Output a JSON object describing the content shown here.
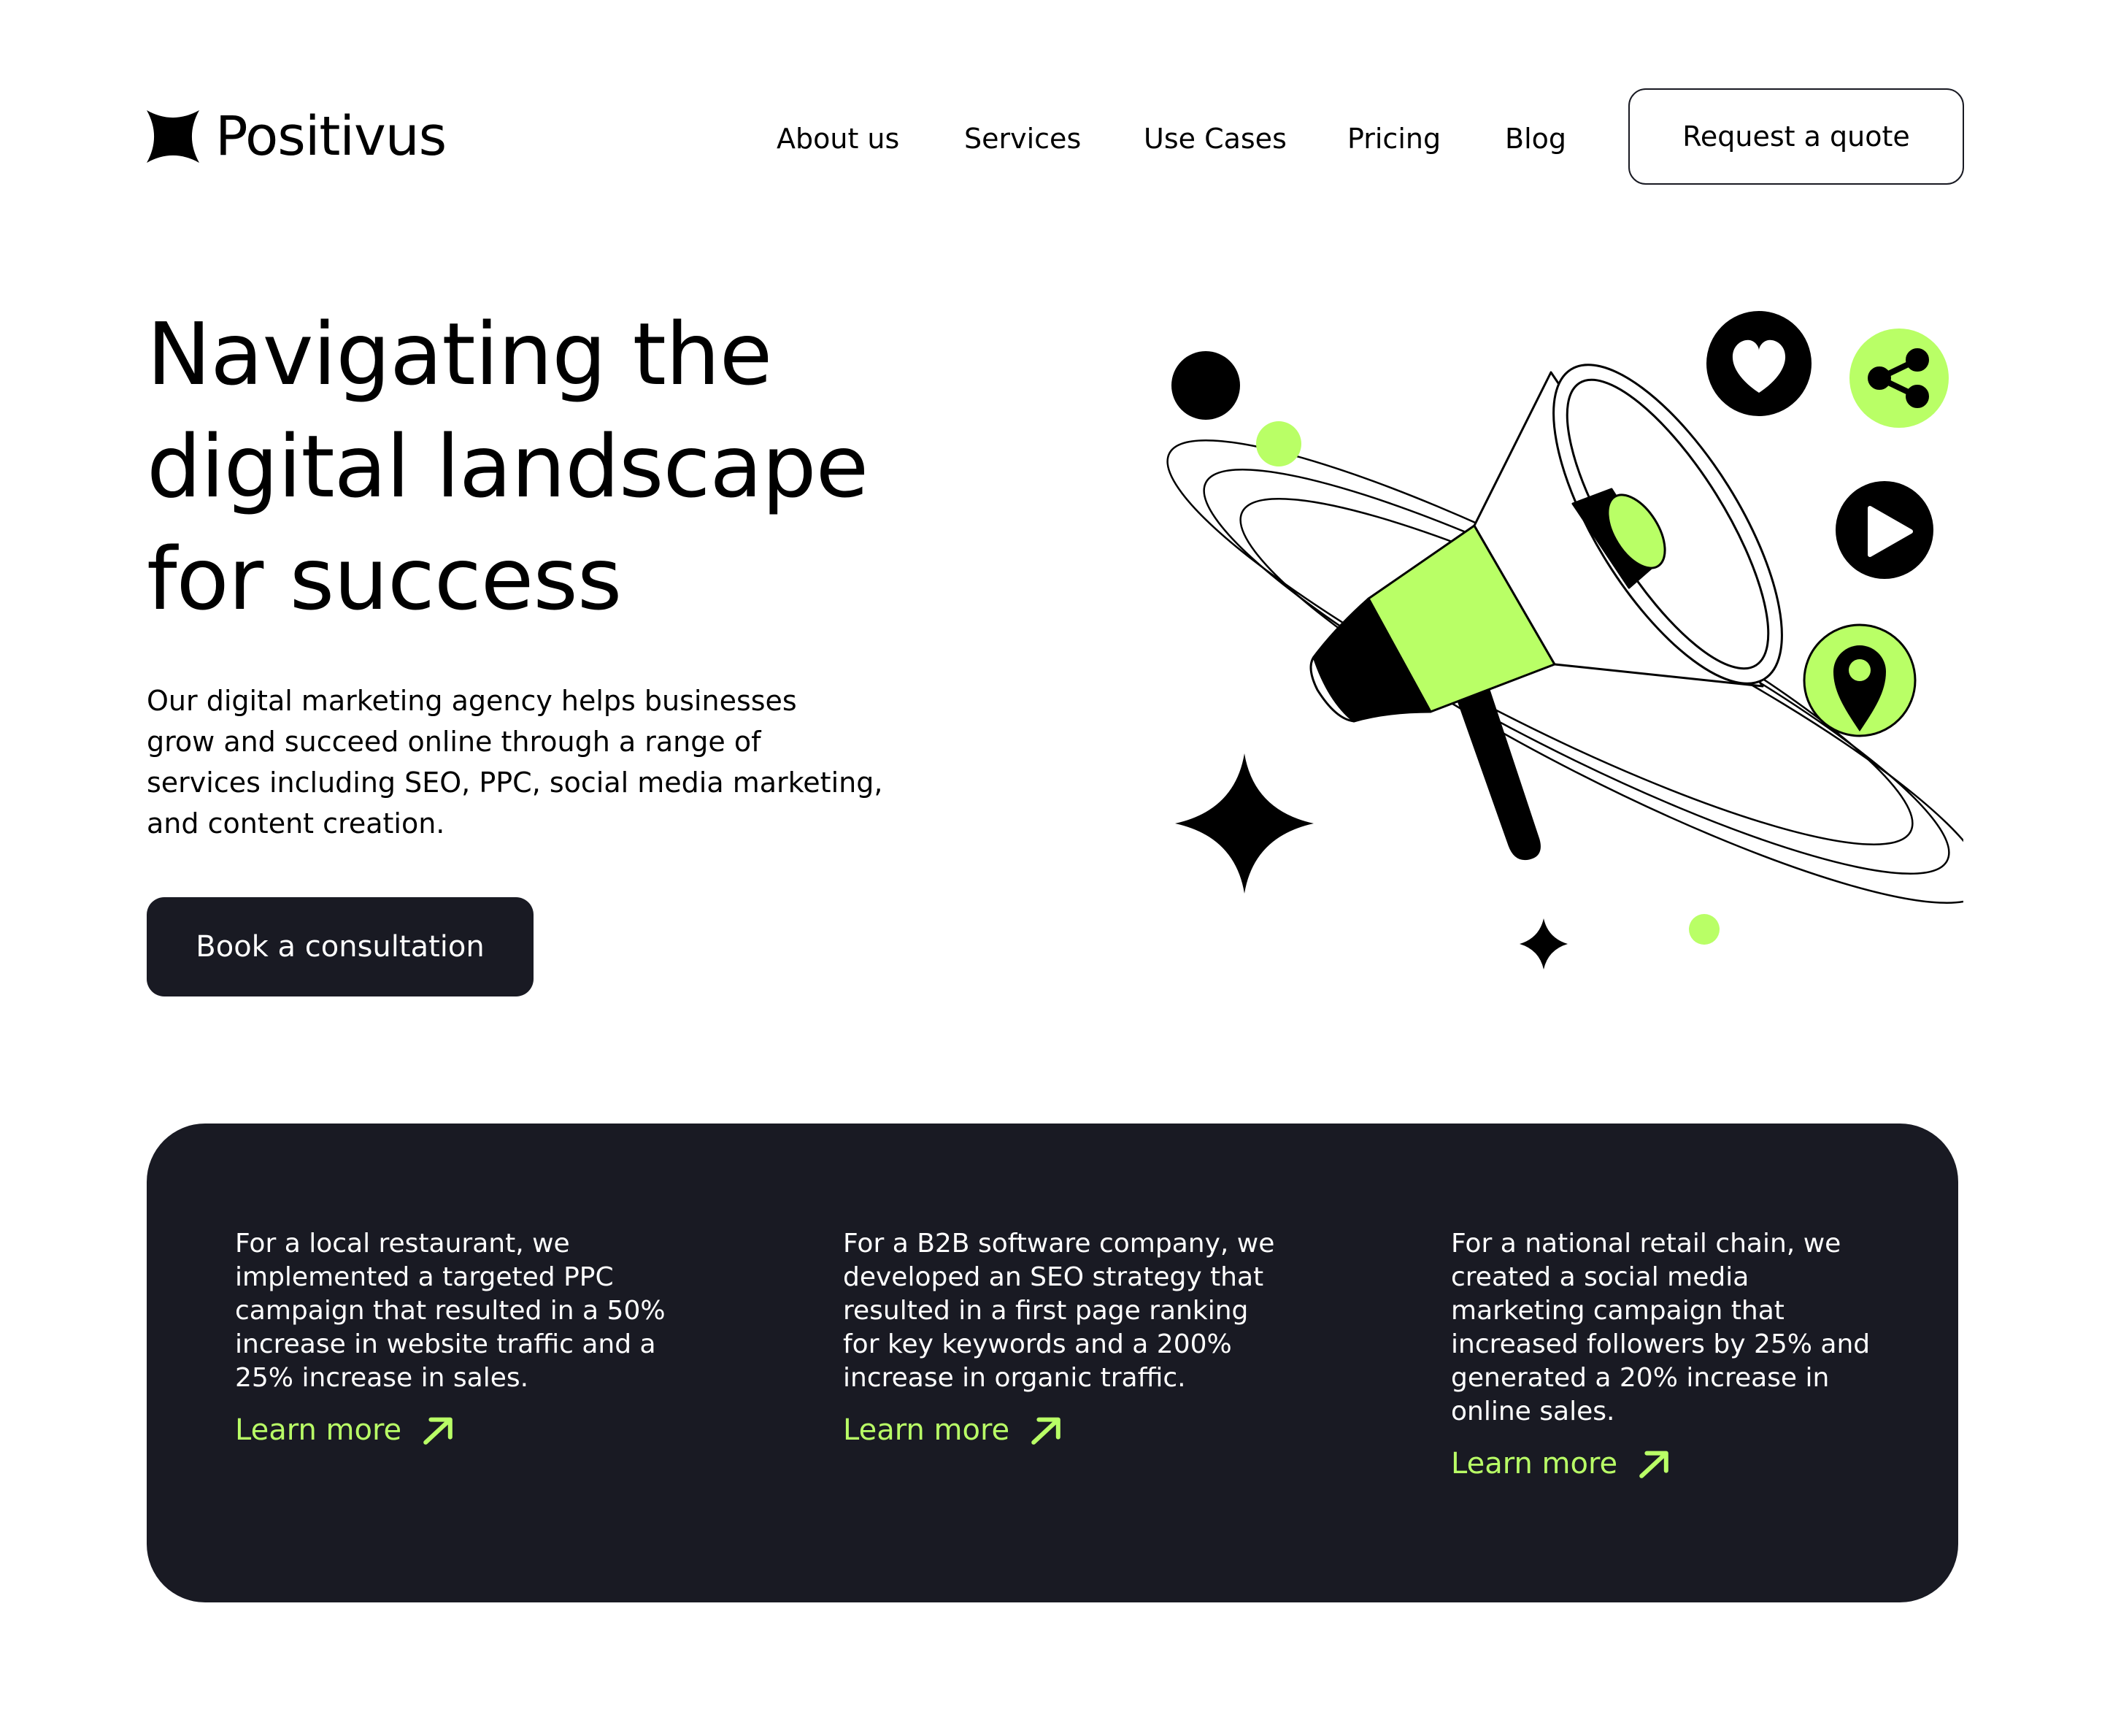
{
  "brand": {
    "name": "Positivus",
    "accent": "#B9FF66",
    "dark": "#191A23"
  },
  "nav": {
    "items": [
      {
        "label": "About us"
      },
      {
        "label": "Services"
      },
      {
        "label": "Use Cases"
      },
      {
        "label": "Pricing"
      },
      {
        "label": "Blog"
      }
    ],
    "cta": "Request a quote"
  },
  "hero": {
    "title_lines": [
      "Navigating the",
      "digital landscape",
      "for success"
    ],
    "description_lines": [
      "Our digital marketing agency helps businesses",
      "grow and succeed online through a range of",
      "services including SEO, PPC, social media marketing,",
      "and content creation."
    ],
    "cta": "Book a consultation",
    "illustration_icons": [
      "megaphone-icon",
      "heart-icon",
      "share-icon",
      "play-icon",
      "location-pin-icon",
      "sparkle-star-icon"
    ]
  },
  "cases": [
    {
      "lines": [
        "For a local restaurant, we",
        "implemented a targeted PPC",
        "campaign that resulted in a 50%",
        "increase in website traffic and a",
        "25% increase in sales."
      ],
      "link": "Learn more"
    },
    {
      "lines": [
        "For a B2B software company, we",
        "developed an SEO strategy that",
        "resulted in a first page ranking",
        "for key keywords and a 200%",
        "increase in organic traffic."
      ],
      "link": "Learn more"
    },
    {
      "lines": [
        "For a national retail chain, we",
        "created a social media",
        "marketing campaign that",
        "increased followers by 25% and",
        "generated a 20% increase in",
        "online sales."
      ],
      "link": "Learn more"
    }
  ]
}
